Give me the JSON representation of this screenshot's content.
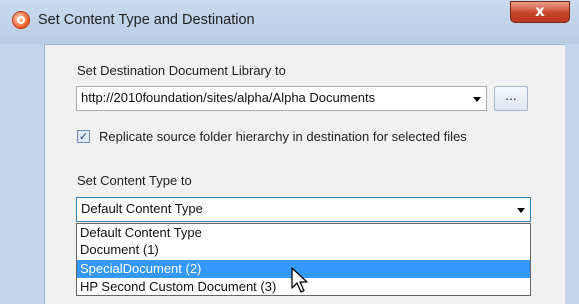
{
  "window": {
    "title": "Set Content Type and Destination",
    "close_label": "x",
    "app_icon": "app-logo-icon"
  },
  "destination": {
    "label": "Set Destination Document Library to",
    "value": "http://2010foundation/sites/alpha/Alpha Documents",
    "browse_label": "..."
  },
  "replicate": {
    "checked": true,
    "label": "Replicate source folder hierarchy in destination for selected files"
  },
  "content_type": {
    "label": "Set Content Type to",
    "value": "Default Content Type",
    "options": [
      "Default Content Type",
      "Document (1)",
      "SpecialDocument (2)",
      "HP Second Custom Document (3)"
    ],
    "highlighted_index": 2
  },
  "colors": {
    "selection": "#3399ff",
    "close_button": "#c8452a",
    "title_bar": "#c9daee"
  }
}
